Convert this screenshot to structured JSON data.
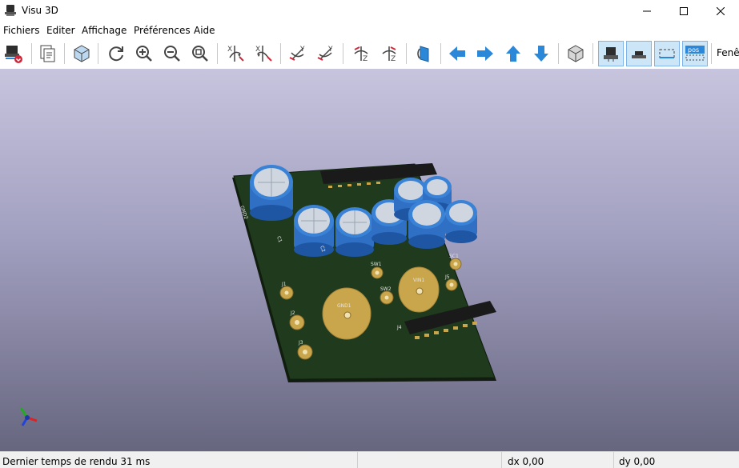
{
  "window": {
    "title": "Visu 3D"
  },
  "menu": {
    "items": [
      "Fichiers",
      "Editer",
      "Affichage",
      "Préférences",
      "Aide"
    ]
  },
  "toolbar": {
    "window_label": "Fenêt",
    "buttons": [
      {
        "name": "reload-board-icon"
      },
      {
        "name": "copy-image-icon"
      },
      {
        "name": "raytracing-icon"
      },
      {
        "name": "refresh-icon"
      },
      {
        "name": "zoom-in-icon"
      },
      {
        "name": "zoom-out-icon"
      },
      {
        "name": "zoom-fit-icon"
      },
      {
        "name": "rotate-x-cw-icon"
      },
      {
        "name": "rotate-x-ccw-icon"
      },
      {
        "name": "rotate-y-cw-icon"
      },
      {
        "name": "rotate-y-ccw-icon"
      },
      {
        "name": "rotate-z-cw-icon"
      },
      {
        "name": "rotate-z-ccw-icon"
      },
      {
        "name": "flip-board-icon"
      },
      {
        "name": "pan-left-icon"
      },
      {
        "name": "pan-right-icon"
      },
      {
        "name": "pan-up-icon"
      },
      {
        "name": "pan-down-icon"
      },
      {
        "name": "orthographic-icon"
      },
      {
        "name": "show-tht-icon"
      },
      {
        "name": "show-smd-icon"
      },
      {
        "name": "show-virtual-icon"
      },
      {
        "name": "show-pos-icon"
      }
    ],
    "active_toggles": [
      "show-tht-icon",
      "show-smd-icon",
      "show-virtual-icon",
      "show-pos-icon"
    ]
  },
  "pcb": {
    "silkscreen": [
      "J1",
      "J2",
      "J3",
      "J4",
      "GND1",
      "VIN1",
      "SW1",
      "SW2",
      "SC1",
      "GND2",
      "C1",
      "C2",
      "J5"
    ]
  },
  "colors": {
    "board": "#1f3a1c",
    "capacitor": "#2c6ec8",
    "pad": "#c9a54b",
    "header": "#1a1a1a",
    "accent": "#2b88d8"
  },
  "status": {
    "render_time": "Dernier temps de rendu 31 ms",
    "dx": "dx 0,00",
    "dy": "dy 0,00"
  }
}
